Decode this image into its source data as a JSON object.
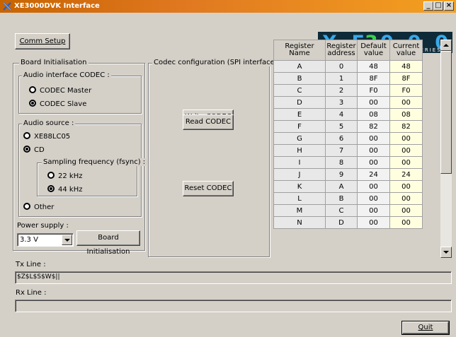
{
  "window": {
    "title": "XE3000DVK Interface",
    "minimize": "_",
    "maximize": "□",
    "close": "×"
  },
  "logo": {
    "main": "XE3000",
    "sub": "SERIES"
  },
  "buttons": {
    "comm_setup": "Comm Setup",
    "write_codec": "Write CODEC",
    "read_codec": "Read CODEC",
    "reset_codec": "Reset CODEC",
    "board_init": "Board Initialisation",
    "quit": "Quit"
  },
  "board_init": {
    "group_label": "Board Initialisation",
    "audio_interface": {
      "label": "Audio interface CODEC :",
      "options": [
        {
          "label": "CODEC Master",
          "selected": false
        },
        {
          "label": "CODEC Slave",
          "selected": true
        }
      ]
    },
    "audio_source": {
      "label": "Audio source :",
      "options": [
        {
          "label": "XE88LC05",
          "selected": false
        },
        {
          "label": "CD",
          "selected": true
        },
        {
          "label": "Other",
          "selected": false
        }
      ],
      "sampling": {
        "label": "Sampling frequency (fsync) :",
        "options": [
          {
            "label": "22 kHz",
            "selected": false
          },
          {
            "label": "44 kHz",
            "selected": true
          }
        ]
      }
    },
    "power_supply": {
      "label": "Power supply :",
      "value": "3.3 V"
    }
  },
  "codec_config": {
    "group_label": "Codec configuration (SPI interface)"
  },
  "register_table": {
    "headers": [
      "Register Name",
      "Register address",
      "Default value",
      "Current value"
    ],
    "rows": [
      [
        "A",
        "0",
        "48",
        "48"
      ],
      [
        "B",
        "1",
        "8F",
        "8F"
      ],
      [
        "C",
        "2",
        "F0",
        "F0"
      ],
      [
        "D",
        "3",
        "00",
        "00"
      ],
      [
        "E",
        "4",
        "08",
        "08"
      ],
      [
        "F",
        "5",
        "82",
        "82"
      ],
      [
        "G",
        "6",
        "00",
        "00"
      ],
      [
        "H",
        "7",
        "00",
        "00"
      ],
      [
        "I",
        "8",
        "00",
        "00"
      ],
      [
        "J",
        "9",
        "24",
        "24"
      ],
      [
        "K",
        "A",
        "00",
        "00"
      ],
      [
        "L",
        "B",
        "00",
        "00"
      ],
      [
        "M",
        "C",
        "00",
        "00"
      ],
      [
        "N",
        "D",
        "00",
        "00"
      ]
    ]
  },
  "tx": {
    "label": "Tx Line :",
    "value": "$Z$L$S$W$||"
  },
  "rx": {
    "label": "Rx Line :",
    "value": ""
  }
}
